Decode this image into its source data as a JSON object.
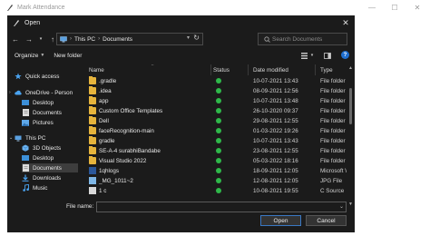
{
  "window": {
    "title": "Mark Attendance"
  },
  "dialog": {
    "title": "Open"
  },
  "address": {
    "crumbs": [
      "This PC",
      "Documents"
    ]
  },
  "search": {
    "placeholder": "Search Documents"
  },
  "toolbar": {
    "organize": "Organize",
    "new_folder": "New folder"
  },
  "columns": {
    "name": "Name",
    "status": "Status",
    "date": "Date modified",
    "type": "Type"
  },
  "nav": [
    {
      "label": "Quick access",
      "icon": "star-icon"
    },
    {
      "label": "OneDrive - Person",
      "icon": "cloud-icon"
    },
    {
      "label": "Desktop",
      "icon": "desktop-icon"
    },
    {
      "label": "Documents",
      "icon": "documents-icon"
    },
    {
      "label": "Pictures",
      "icon": "pictures-icon"
    },
    {
      "label": "This PC",
      "icon": "computer-icon"
    },
    {
      "label": "3D Objects",
      "icon": "cube-icon"
    },
    {
      "label": "Desktop",
      "icon": "desktop-icon"
    },
    {
      "label": "Documents",
      "icon": "documents-icon"
    },
    {
      "label": "Downloads",
      "icon": "download-icon"
    },
    {
      "label": "Music",
      "icon": "music-icon"
    }
  ],
  "files": [
    {
      "name": ".gradle",
      "date": "10-07-2021 13:43",
      "type": "File folder",
      "icon": "folder"
    },
    {
      "name": ".idea",
      "date": "08-09-2021 12:56",
      "type": "File folder",
      "icon": "folder"
    },
    {
      "name": "app",
      "date": "10-07-2021 13:48",
      "type": "File folder",
      "icon": "folder"
    },
    {
      "name": "Custom Office Templates",
      "date": "26-10-2020 09:37",
      "type": "File folder",
      "icon": "folder"
    },
    {
      "name": "Dell",
      "date": "29-08-2021 12:55",
      "type": "File folder",
      "icon": "folder"
    },
    {
      "name": "faceRecognition-main",
      "date": "01-03-2022 19:26",
      "type": "File folder",
      "icon": "folder"
    },
    {
      "name": "gradle",
      "date": "10-07-2021 13:43",
      "type": "File folder",
      "icon": "folder"
    },
    {
      "name": "SE-A-4 surabhiBandabe",
      "date": "23-08-2021 12:55",
      "type": "File folder",
      "icon": "folder"
    },
    {
      "name": "Visual Studio 2022",
      "date": "05-03-2022 18:16",
      "type": "File folder",
      "icon": "folder"
    },
    {
      "name": "1qhlogs",
      "date": "18-09-2021 12:05",
      "type": "Microsoft Wo",
      "icon": "word"
    },
    {
      "name": "_MG_1011~2",
      "date": "12-08-2021 12:05",
      "type": "JPG File",
      "icon": "image"
    },
    {
      "name": "1 c",
      "date": "10-08-2021 19:55",
      "type": "C Source",
      "icon": "file"
    }
  ],
  "filename": {
    "label": "File name:",
    "value": ""
  },
  "buttons": {
    "open": "Open",
    "cancel": "Cancel"
  },
  "colors": {
    "status_ok": "#2fb84a",
    "folder": "#e6b43c",
    "accent": "#1f6fd0"
  }
}
